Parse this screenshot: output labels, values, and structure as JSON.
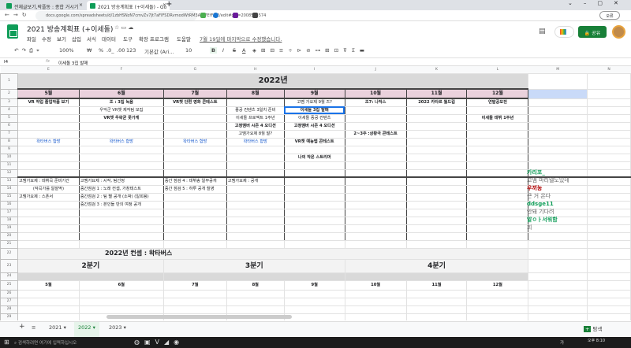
{
  "browser": {
    "tabs": [
      {
        "label": "전체글보기,락플동 : 종합 거시기"
      },
      {
        "label": "2021 방송계획표 (+이세돌) - Go"
      }
    ],
    "url": "docs.google.com/spreadsheets/d/1zbHSNzN7cmvZv7Jt7aFIFSDRvmodWtRM3Azs7EfFJYE/edit#gid=2008553574",
    "profile": "오류"
  },
  "doc": {
    "title": "2021 방송계획표 (+이세돌)",
    "menus": [
      "파일",
      "수정",
      "보기",
      "삽입",
      "서식",
      "데이터",
      "도구",
      "확장 프로그램",
      "도움말"
    ],
    "last_edit": "7월 19일에 마지막으로 수정했습니다.",
    "share": "공유"
  },
  "toolbar": {
    "zoom": "100%",
    "currency": "₩",
    "percent": "%",
    "dec_minus": ".0_",
    "dec_plus": ".00",
    "format": "123",
    "font": "기본값 (Ari...",
    "size": "10",
    "bold": "B",
    "italic": "I",
    "strike": "S",
    "color": "A"
  },
  "formula": {
    "cell": "I4",
    "fx": "fx",
    "value": "이세돌 3집 발매"
  },
  "grid": {
    "columns": [
      "E",
      "F",
      "G",
      "H",
      "I",
      "J",
      "K",
      "L",
      "M",
      "N"
    ],
    "year_title": "2022년",
    "months": [
      "5월",
      "6월",
      "7월",
      "8월",
      "9월",
      "10월",
      "11월",
      "12월"
    ],
    "cells": {
      "3": {
        "E": "VR 작업 졸업작품 보기",
        "F": "조 : 3집 녹음",
        "G": "VR챗 단편 영화 콘테스트",
        "I": "고멤 가요제 9월 즈?",
        "J": "조7: 나작스",
        "K": "2022 카타르 월드컵",
        "L": "연말공모전"
      },
      "4": {
        "F": "우악군 VR챗 제작팀 모집",
        "H": "종공 컨텐츠 3일치 준비",
        "I": "이세돌 3집 발매"
      },
      "5": {
        "F": "VR챗 우왁굳 못가게",
        "H": "이세돌 프로젝트 1주년",
        "I": "이세돌 중공 컨텐츠",
        "L": "이세돌 데뷔 1주년"
      },
      "6": {
        "H": "고정멤버 시즌 4 오디션",
        "I": "고정멤버 시즌 4 오디션"
      },
      "7": {
        "H": "고멤가요제 8월 말?",
        "J": "2~3주 :상황극 콘테스트"
      },
      "8": {
        "E": "왁타버스 합방",
        "F": "왁타버스 합방",
        "G": "왁타버스 합방",
        "H": "왁타버스 합방",
        "I": "VR챗 예능맵 콘테스트"
      },
      "10": {
        "I": "나의 작은 스트리머"
      },
      "13": {
        "E": "고멤가요제 : 데뷔곡 준비기간",
        "F": "고멤가요제 : 시작, 팀선정",
        "G": "중간 점검 4 : 데뷔송 일부공개",
        "H": "고멤가요제 : 공개"
      },
      "14": {
        "E": "(작곡가를 알잘딱)",
        "F": "중간점검 1 : 노래 컨셉, 가창테스트",
        "G": "중간 점검 5 : 하루 공개 촬영"
      },
      "15": {
        "E": "고멤가요제 : 스폰서",
        "F": "중간점검 2 : 팀 별 공개 (소박) (일회용)"
      },
      "16": {
        "F": "중간점검 3 : 본인들 만의 여정 공개"
      }
    },
    "concept_title": "2022년 컨셉 : 왁타버스",
    "quarters": [
      "2분기",
      "3분기",
      "4분기"
    ]
  },
  "chat": [
    {
      "user": "카리포_",
      "msg": "고멤 마리텔도있네",
      "color": "#0f9d58"
    },
    {
      "user": "우끼농",
      "msg": "큰 거 온다",
      "color": "#b00000"
    },
    {
      "user": "ddsge11",
      "msg": "안돼 기다려",
      "color": "#0f9d58"
    },
    {
      "user": "알ㅇㅏ서워함",
      "msg": "희",
      "color": "#0f9d58"
    }
  ],
  "sheets": {
    "tabs": [
      "2021",
      "2022",
      "2023"
    ],
    "active": "2022",
    "explore": "탐색"
  },
  "taskbar": {
    "search": "검색하려면 여기에 입력하십시오",
    "time": "오후 8:10",
    "ime": "가"
  }
}
